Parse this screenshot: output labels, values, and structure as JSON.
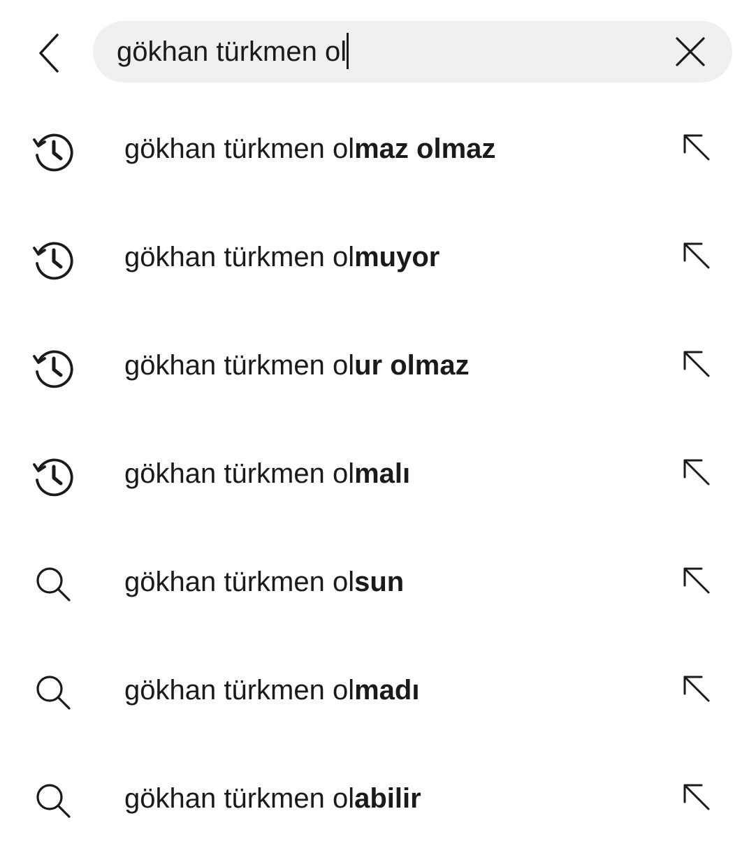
{
  "search": {
    "query": "gökhan türkmen ol"
  },
  "icons": {
    "back": "chevron-left-icon",
    "clear": "close-icon",
    "history": "history-clock-icon",
    "search": "search-icon",
    "fill": "arrow-up-left-icon"
  },
  "suggestions": [
    {
      "type": "history",
      "prefix": "gökhan türkmen ol",
      "completion": "maz olmaz"
    },
    {
      "type": "history",
      "prefix": "gökhan türkmen ol",
      "completion": "muyor"
    },
    {
      "type": "history",
      "prefix": "gökhan türkmen ol",
      "completion": "ur olmaz"
    },
    {
      "type": "history",
      "prefix": "gökhan türkmen ol",
      "completion": "malı"
    },
    {
      "type": "search",
      "prefix": "gökhan türkmen ol",
      "completion": "sun"
    },
    {
      "type": "search",
      "prefix": "gökhan türkmen ol",
      "completion": "madı"
    },
    {
      "type": "search",
      "prefix": "gökhan türkmen ol",
      "completion": "abilir"
    }
  ],
  "colors": {
    "text": "#1a1a1a",
    "search_bar_bg": "#efefef",
    "background": "#ffffff"
  }
}
